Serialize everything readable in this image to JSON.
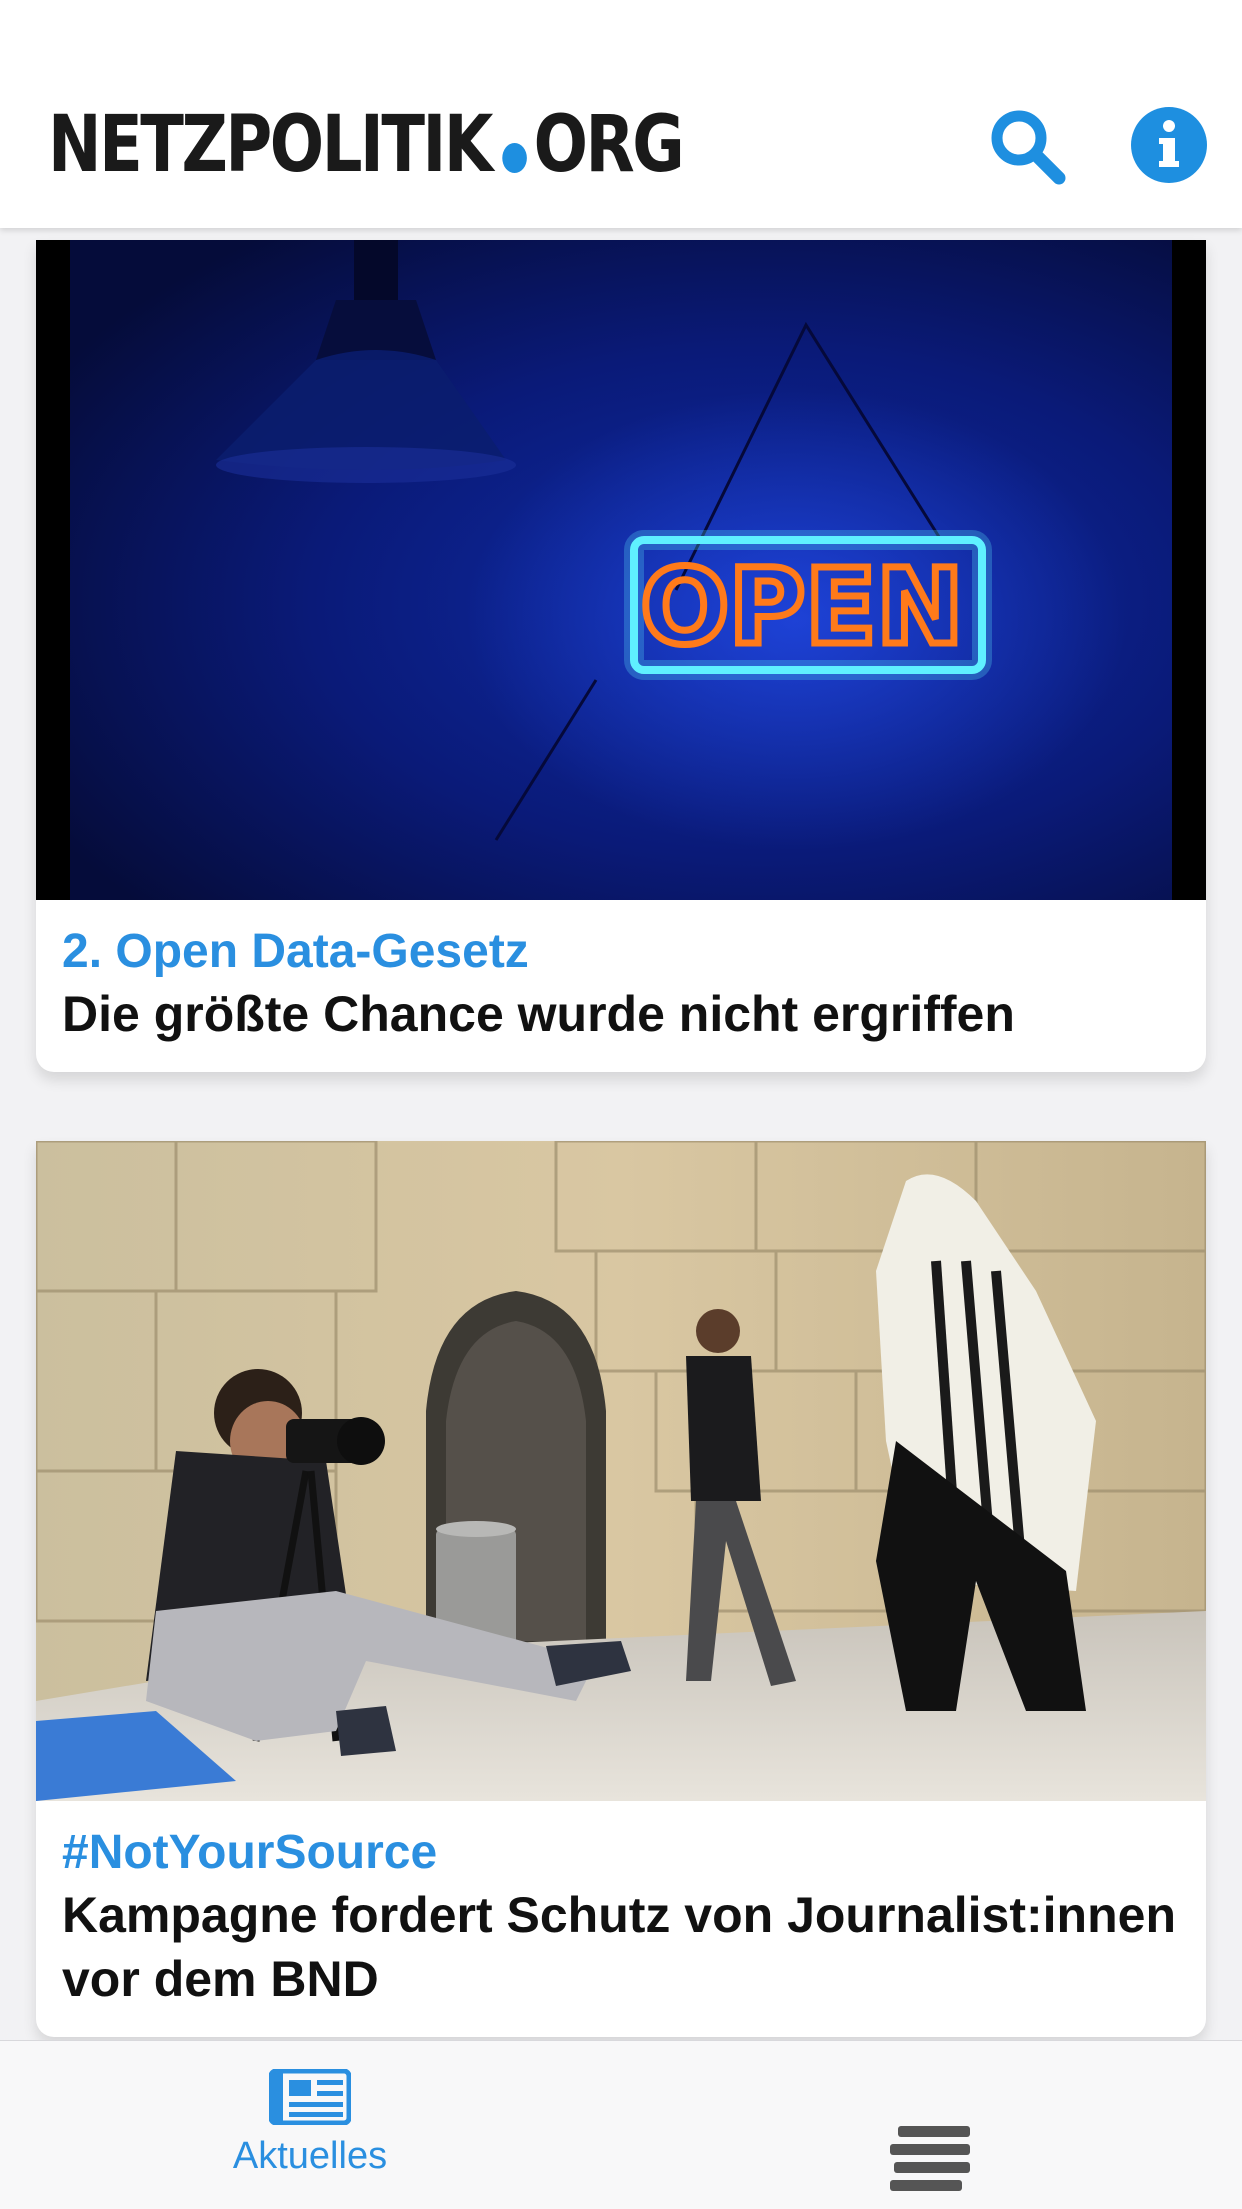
{
  "header": {
    "logo_left": "NETZPOLITIK",
    "logo_right": "ORG",
    "search_icon": "search-icon",
    "info_icon": "info-icon"
  },
  "articles": [
    {
      "kicker": "2. Open Data-Gesetz",
      "headline": "Die größte Chance wurde nicht ergriffen",
      "image_sign_text": "OPEN"
    },
    {
      "kicker": "#NotYourSource",
      "headline": "Kampagne fordert Schutz von Journalist:innen vor dem BND"
    }
  ],
  "tabbar": {
    "news_label": "Aktuelles",
    "news_icon": "newspaper-icon",
    "menu_icon": "menu-icon"
  },
  "colors": {
    "accent": "#2a8fe0",
    "text": "#111111",
    "header_bg": "#ffffff"
  }
}
